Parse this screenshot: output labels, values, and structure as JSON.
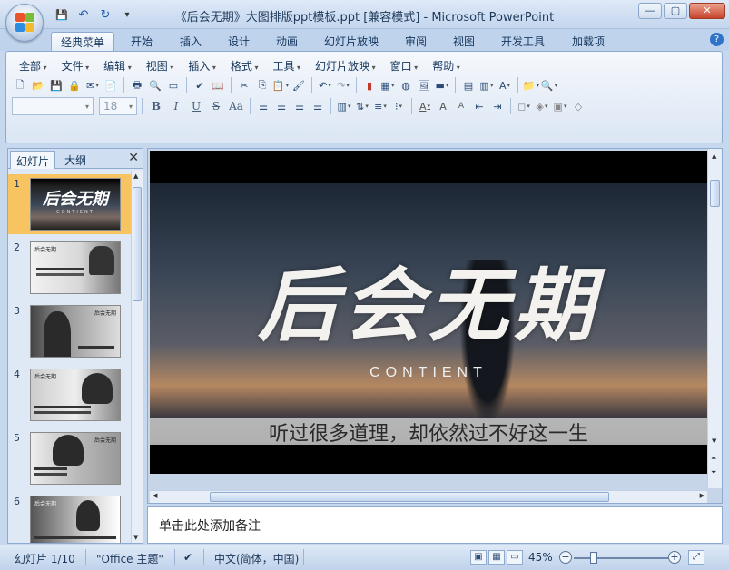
{
  "window": {
    "title": "《后会无期》大图排版ppt模板.ppt [兼容模式] - Microsoft PowerPoint",
    "controls": [
      "—",
      "▢",
      "✕"
    ]
  },
  "qat": {
    "save_icon": "💾",
    "undo_icon": "↶",
    "redo_icon": "↻",
    "customize_icon": "▾"
  },
  "ribbon_tabs": [
    "经典菜单",
    "开始",
    "插入",
    "设计",
    "动画",
    "幻灯片放映",
    "审阅",
    "视图",
    "开发工具",
    "加载项"
  ],
  "help_label": "?",
  "classic_menu": [
    "全部",
    "文件",
    "编辑",
    "视图",
    "插入",
    "格式",
    "工具",
    "幻灯片放映",
    "窗口",
    "帮助"
  ],
  "font_box": {
    "font_name": "",
    "font_size": "18"
  },
  "format_buttons": [
    "B",
    "I",
    "U",
    "S",
    "Aa"
  ],
  "slides_panel": {
    "tab_slides": "幻灯片",
    "tab_outline": "大纲",
    "close_label": "✕",
    "slides": [
      {
        "num": "1",
        "title": "后会无期",
        "sub": "CONTIENT"
      },
      {
        "num": "2",
        "title": "后会无期",
        "sub": ""
      },
      {
        "num": "3",
        "title": "后会无期",
        "sub": ""
      },
      {
        "num": "4",
        "title": "后会无期",
        "sub": ""
      },
      {
        "num": "5",
        "title": "后会无期",
        "sub": ""
      },
      {
        "num": "6",
        "title": "后会无期",
        "sub": ""
      }
    ]
  },
  "slide": {
    "title": "后会无期",
    "subtitle": "CONTIENT",
    "caption": "听过很多道理，却依然过不好这一生"
  },
  "notes": {
    "placeholder": "单击此处添加备注"
  },
  "status": {
    "slide_info": "幻灯片 1/10",
    "theme": "\"Office 主题\"",
    "language": "中文(简体，中国)",
    "zoom": "45%"
  },
  "colors": {
    "selected_thumb": "#f8c361",
    "ribbon_bg": "#dbe6f4",
    "frame_blue": "#8eaad0"
  }
}
